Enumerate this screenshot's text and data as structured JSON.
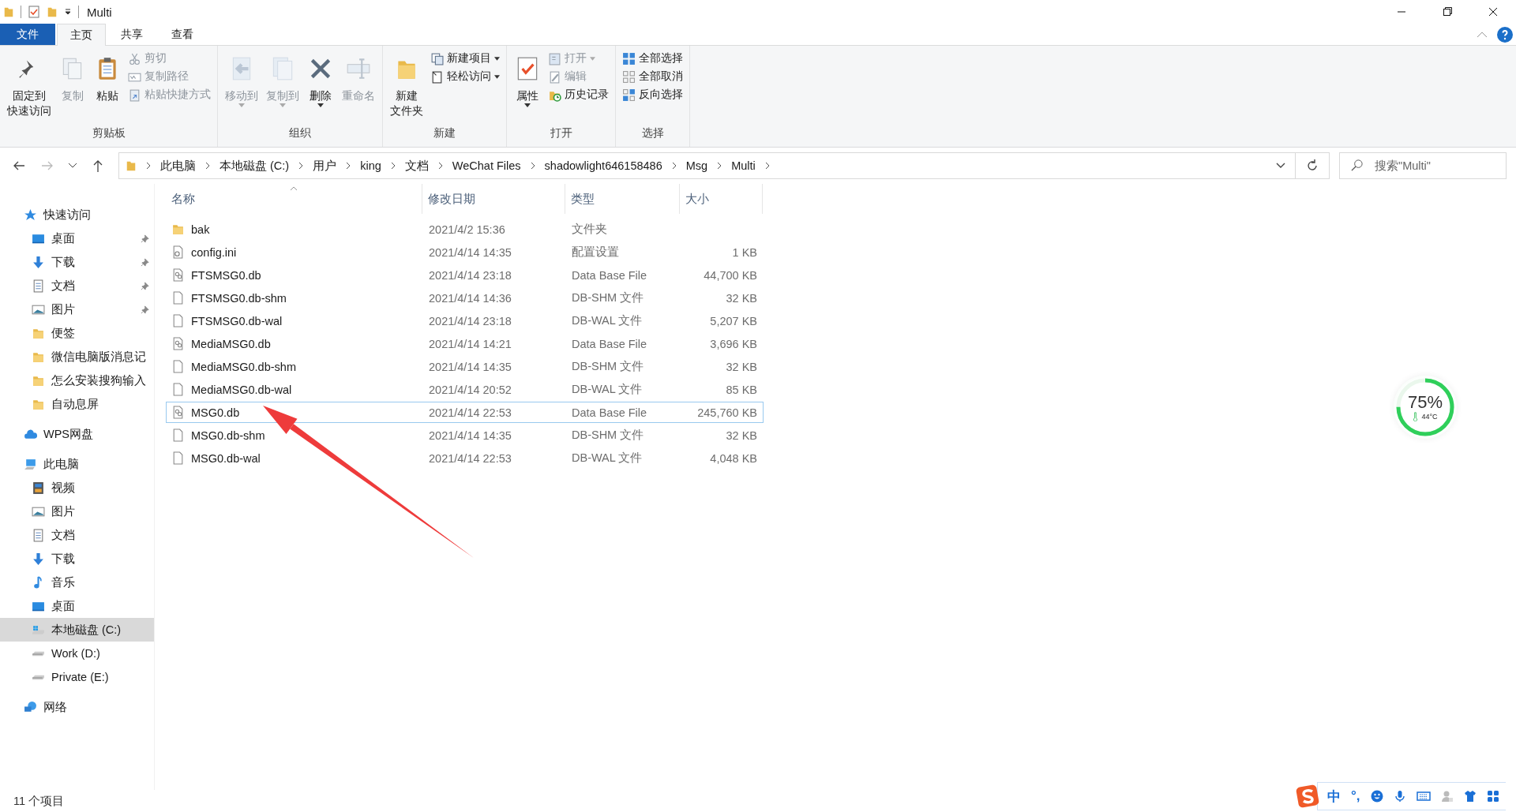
{
  "window": {
    "title": "Multi"
  },
  "tabs": [
    {
      "label": "文件",
      "kind": "file",
      "selected": false
    },
    {
      "label": "主页",
      "kind": "tab",
      "selected": true
    },
    {
      "label": "共享",
      "kind": "tab",
      "selected": false
    },
    {
      "label": "查看",
      "kind": "tab",
      "selected": false
    }
  ],
  "ribbon": [
    {
      "label": "剪贴板",
      "items": [
        {
          "kind": "large",
          "label": [
            "固定到",
            "快速访问"
          ],
          "disabled": false,
          "dropdown": false
        },
        {
          "kind": "large",
          "label": [
            "复制"
          ],
          "disabled": true,
          "dropdown": false
        },
        {
          "kind": "large",
          "label": [
            "粘贴"
          ],
          "disabled": false,
          "dropdown": false
        },
        {
          "kind": "small",
          "label": "剪切",
          "disabled": true,
          "dropdown": false
        },
        {
          "kind": "small",
          "label": "复制路径",
          "disabled": true,
          "dropdown": false
        },
        {
          "kind": "small",
          "label": "粘贴快捷方式",
          "disabled": true,
          "dropdown": false
        }
      ]
    },
    {
      "label": "组织",
      "items": [
        {
          "kind": "large",
          "label": [
            "移动到"
          ],
          "disabled": true,
          "dropdown": true
        },
        {
          "kind": "large",
          "label": [
            "复制到"
          ],
          "disabled": true,
          "dropdown": true
        },
        {
          "kind": "large",
          "label": [
            "删除"
          ],
          "disabled": false,
          "dropdown": true
        },
        {
          "kind": "large",
          "label": [
            "重命名"
          ],
          "disabled": true,
          "dropdown": false
        }
      ]
    },
    {
      "label": "新建",
      "items": [
        {
          "kind": "large",
          "label": [
            "新建",
            "文件夹"
          ],
          "disabled": false,
          "dropdown": false
        },
        {
          "kind": "small",
          "label": "新建项目",
          "disabled": false,
          "dropdown": true
        },
        {
          "kind": "small",
          "label": "轻松访问",
          "disabled": false,
          "dropdown": true
        }
      ]
    },
    {
      "label": "打开",
      "items": [
        {
          "kind": "large",
          "label": [
            "属性"
          ],
          "disabled": false,
          "dropdown": true
        },
        {
          "kind": "small",
          "label": "打开",
          "disabled": true,
          "dropdown": true
        },
        {
          "kind": "small",
          "label": "编辑",
          "disabled": true,
          "dropdown": false
        },
        {
          "kind": "small",
          "label": "历史记录",
          "disabled": false,
          "dropdown": false
        }
      ]
    },
    {
      "label": "选择",
      "items": [
        {
          "kind": "small",
          "label": "全部选择",
          "disabled": false,
          "dropdown": false
        },
        {
          "kind": "small",
          "label": "全部取消",
          "disabled": false,
          "dropdown": false
        },
        {
          "kind": "small",
          "label": "反向选择",
          "disabled": false,
          "dropdown": false
        }
      ]
    }
  ],
  "breadcrumb": [
    "此电脑",
    "本地磁盘 (C:)",
    "用户",
    "king",
    "文档",
    "WeChat Files",
    "shadowlight646158486",
    "Msg",
    "Multi"
  ],
  "search": {
    "placeholder": "搜索\"Multi\""
  },
  "nav": [
    {
      "label": "快速访问",
      "selected": false,
      "children": [
        {
          "label": "桌面",
          "pinned": true,
          "selected": false
        },
        {
          "label": "下载",
          "pinned": true,
          "selected": false
        },
        {
          "label": "文档",
          "pinned": true,
          "selected": false
        },
        {
          "label": "图片",
          "pinned": true,
          "selected": false
        },
        {
          "label": "便签",
          "pinned": false,
          "selected": false
        },
        {
          "label": "微信电脑版消息记",
          "pinned": false,
          "selected": false
        },
        {
          "label": "怎么安装搜狗输入",
          "pinned": false,
          "selected": false
        },
        {
          "label": "自动息屏",
          "pinned": false,
          "selected": false
        }
      ]
    },
    {
      "label": "WPS网盘",
      "selected": false
    },
    {
      "label": "此电脑",
      "selected": false,
      "children": [
        {
          "label": "视频",
          "selected": false
        },
        {
          "label": "图片",
          "selected": false
        },
        {
          "label": "文档",
          "selected": false
        },
        {
          "label": "下载",
          "selected": false
        },
        {
          "label": "音乐",
          "selected": false
        },
        {
          "label": "桌面",
          "selected": false
        },
        {
          "label": "本地磁盘 (C:)",
          "selected": true
        },
        {
          "label": "Work (D:)",
          "selected": false
        },
        {
          "label": "Private (E:)",
          "selected": false
        }
      ]
    },
    {
      "label": "网络",
      "selected": false
    }
  ],
  "table": {
    "columns": [
      "名称",
      "修改日期",
      "类型",
      "大小"
    ],
    "rows": [
      {
        "name": "bak",
        "date": "2021/4/2 15:36",
        "type": "文件夹",
        "size": "",
        "focused": false
      },
      {
        "name": "config.ini",
        "date": "2021/4/14 14:35",
        "type": "配置设置",
        "size": "1 KB",
        "focused": false
      },
      {
        "name": "FTSMSG0.db",
        "date": "2021/4/14 23:18",
        "type": "Data Base File",
        "size": "44,700 KB",
        "focused": false
      },
      {
        "name": "FTSMSG0.db-shm",
        "date": "2021/4/14 14:36",
        "type": "DB-SHM 文件",
        "size": "32 KB",
        "focused": false
      },
      {
        "name": "FTSMSG0.db-wal",
        "date": "2021/4/14 23:18",
        "type": "DB-WAL 文件",
        "size": "5,207 KB",
        "focused": false
      },
      {
        "name": "MediaMSG0.db",
        "date": "2021/4/14 14:21",
        "type": "Data Base File",
        "size": "3,696 KB",
        "focused": false
      },
      {
        "name": "MediaMSG0.db-shm",
        "date": "2021/4/14 14:35",
        "type": "DB-SHM 文件",
        "size": "32 KB",
        "focused": false
      },
      {
        "name": "MediaMSG0.db-wal",
        "date": "2021/4/14 20:52",
        "type": "DB-WAL 文件",
        "size": "85 KB",
        "focused": false
      },
      {
        "name": "MSG0.db",
        "date": "2021/4/14 22:53",
        "type": "Data Base File",
        "size": "245,760 KB",
        "focused": true
      },
      {
        "name": "MSG0.db-shm",
        "date": "2021/4/14 14:35",
        "type": "DB-SHM 文件",
        "size": "32 KB",
        "focused": false
      },
      {
        "name": "MSG0.db-wal",
        "date": "2021/4/14 22:53",
        "type": "DB-WAL 文件",
        "size": "4,048 KB",
        "focused": false
      }
    ]
  },
  "status_bar": "11 个项目",
  "widget": {
    "percent": "75%",
    "temp": "44°C",
    "level": 0.75
  },
  "ime": {
    "mode": "中",
    "punct": "°,"
  }
}
